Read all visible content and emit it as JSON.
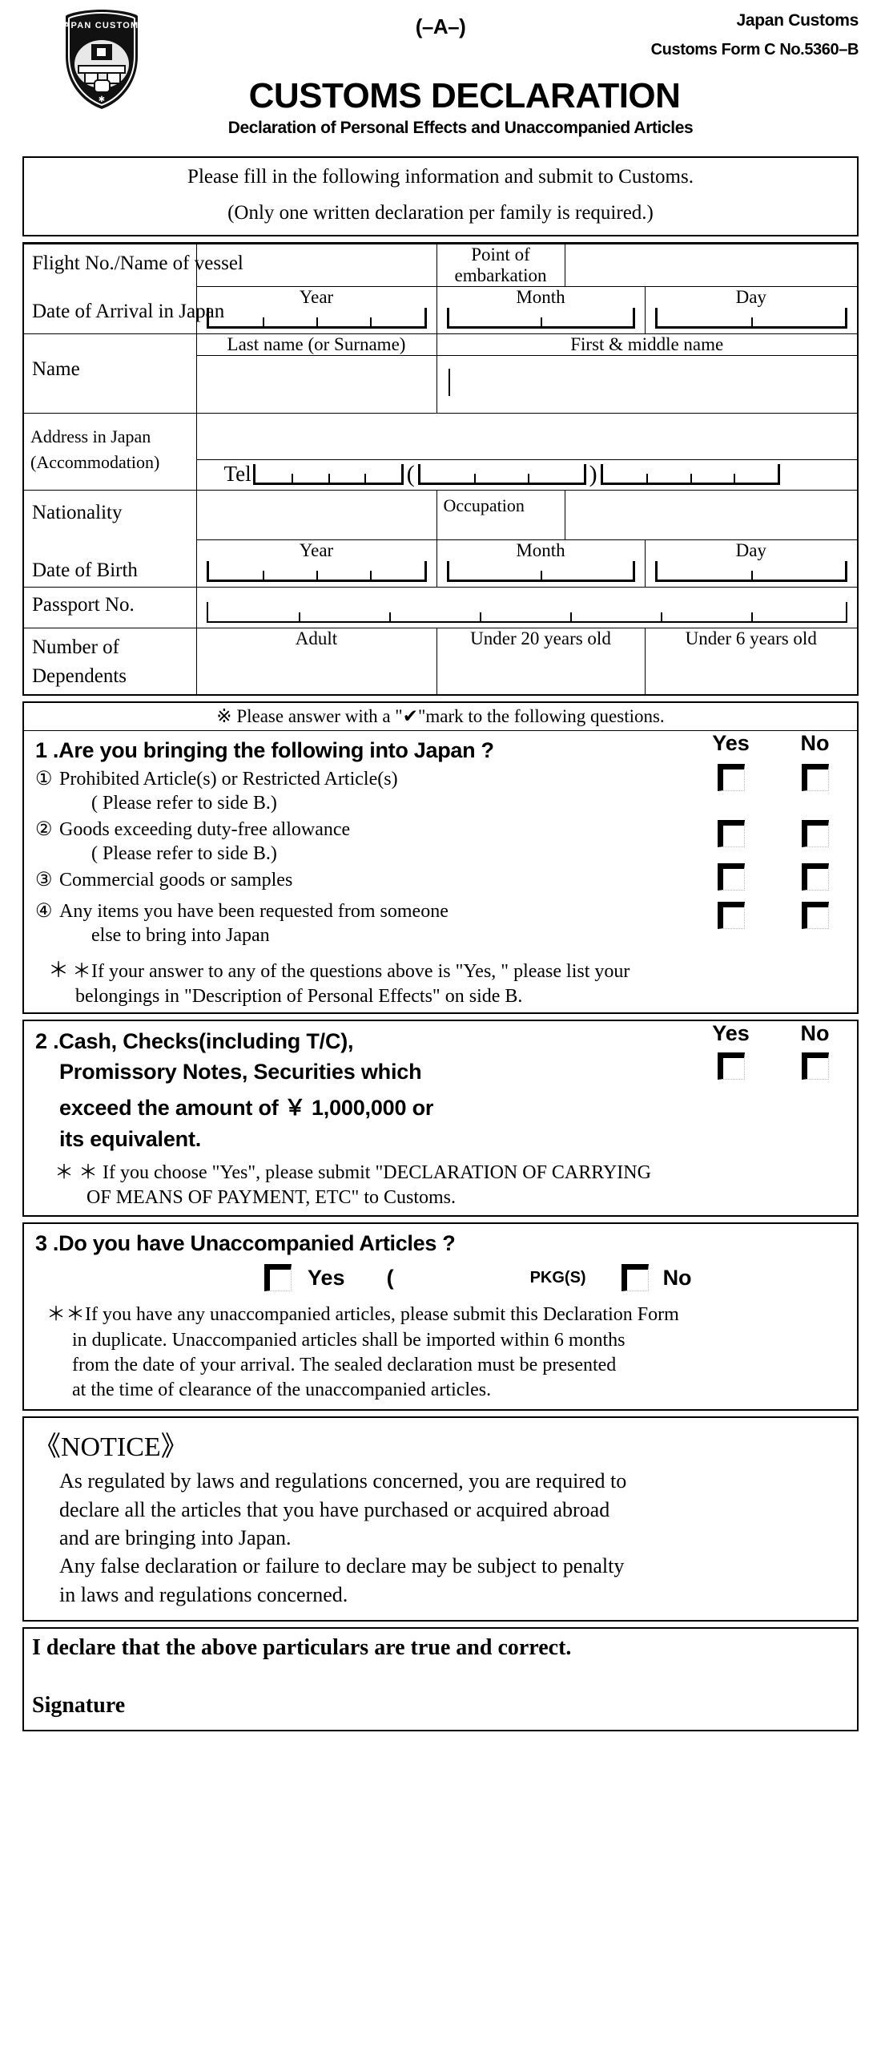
{
  "header": {
    "side_mark": "(–A–)",
    "agency": "Japan Customs",
    "form_no": "Customs Form C No.5360–B",
    "title": "CUSTOMS DECLARATION",
    "subtitle": "Declaration of Personal Effects and Unaccompanied Articles",
    "crest_text": "JAPAN CUSTOMS"
  },
  "instructions": {
    "line1": "Please fill in the following information and submit to Customs.",
    "line2": "(Only one written declaration per family is required.)"
  },
  "personal": {
    "flight_label": "Flight No./Name of vessel",
    "embarkation_label": "Point of embarkation",
    "arrival_label": "Date of Arrival in Japan",
    "arrival_year": "Year",
    "arrival_month": "Month",
    "arrival_day": "Day",
    "name_label": "Name",
    "last_name_label": "Last name (or Surname)",
    "first_name_label": "First & middle name",
    "address_label_1": "Address in Japan",
    "address_label_2": "(Accommodation)",
    "tel_label": "Tel",
    "nationality_label": "Nationality",
    "occupation_label": "Occupation",
    "dob_label": "Date of Birth",
    "dob_year": "Year",
    "dob_month": "Month",
    "dob_day": "Day",
    "passport_label": "Passport No.",
    "dependents_label_1": "Number of",
    "dependents_label_2": "Dependents",
    "dep_adult": "Adult",
    "dep_under20": "Under 20 years old",
    "dep_under6": "Under 6 years old"
  },
  "questions": {
    "checkmark_note": "※ Please answer with a \"✔\"mark to the following questions.",
    "yes_label": "Yes",
    "no_label": "No",
    "q1": {
      "heading": "1 .Are you bringing the following into Japan ?",
      "items": [
        {
          "num": "①",
          "text": "Prohibited Article(s) or Restricted Article(s)",
          "sub": "( Please refer to side B.)"
        },
        {
          "num": "②",
          "text": "Goods exceeding duty-free allowance",
          "sub": "( Please refer to side B.)"
        },
        {
          "num": "③",
          "text": "Commercial goods or samples",
          "sub": ""
        },
        {
          "num": "④",
          "text": "Any items you have been requested from someone",
          "sub": "else to bring into Japan"
        }
      ],
      "note_line1": "＊If your answer to any of the questions above is \"Yes, \" please list your",
      "note_line2": "belongings in \"Description of Personal Effects\" on side B."
    },
    "q2": {
      "line1": "2 .Cash, Checks(including T/C),",
      "line2": "Promissory  Notes, Securities which",
      "line3": "exceed the amount of  ￥ 1,000,000 or",
      "line4": "its equivalent.",
      "note_line1": "＊ If you choose \"Yes\", please submit \"DECLARATION OF   CARRYING",
      "note_line2": "OF  MEANS  OF  PAYMENT,  ETC\" to Customs."
    },
    "q3": {
      "heading": "3 .Do you have Unaccompanied Articles ?",
      "yes_label": "Yes",
      "open_paren": "(",
      "pkg_label": "PKG(S)",
      "no_label": "No",
      "note_line1": "＊If you have any unaccompanied articles, please submit this Declaration Form",
      "note_line2": "in duplicate. Unaccompanied articles shall be imported within 6 months",
      "note_line3": "from the date of your arrival. The sealed declaration must be presented",
      "note_line4": "at the time of clearance of the unaccompanied articles."
    }
  },
  "notice": {
    "title": "《NOTICE》",
    "line1": "As regulated by laws and regulations concerned, you are required to",
    "line2": "declare all the articles that you have purchased or acquired abroad",
    "line3": "and are bringing into Japan.",
    "line4": "Any false declaration or failure to declare may be subject to penalty",
    "line5": "in laws  and regulations concerned."
  },
  "declaration": {
    "text": "I declare that the above particulars are true and correct.",
    "signature_label": "Signature"
  }
}
